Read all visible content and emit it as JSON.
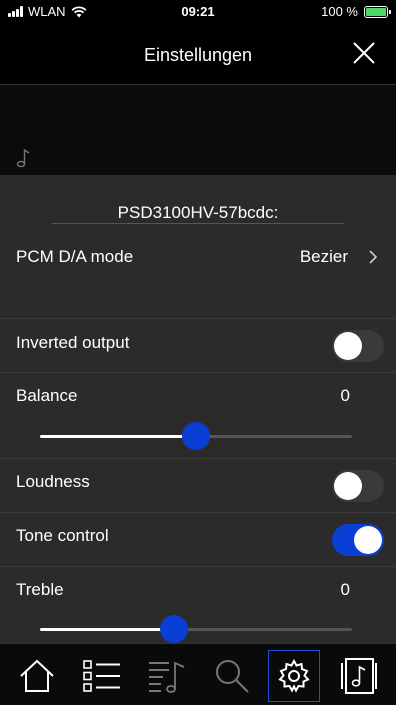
{
  "status": {
    "carrier": "WLAN",
    "time": "09:21",
    "battery": "100 %"
  },
  "nav": {
    "title": "Einstellungen"
  },
  "device": {
    "name": "PSD3100HV-57bcdc:"
  },
  "settings": {
    "pcm_mode": {
      "label": "PCM D/A mode",
      "value": "Bezier"
    },
    "inverted_output": {
      "label": "Inverted output",
      "on": false
    },
    "balance": {
      "label": "Balance",
      "value": "0",
      "position": 0.5
    },
    "loudness": {
      "label": "Loudness",
      "on": false
    },
    "tone_control": {
      "label": "Tone control",
      "on": true
    },
    "treble": {
      "label": "Treble",
      "value": "0",
      "position": 0.43
    }
  },
  "tabs": [
    {
      "icon": "home-icon"
    },
    {
      "icon": "list-icon"
    },
    {
      "icon": "playlist-icon"
    },
    {
      "icon": "search-icon"
    },
    {
      "icon": "settings-gear-icon",
      "selected": true
    },
    {
      "icon": "music-library-icon"
    }
  ],
  "colors": {
    "accent": "#0a3fd6",
    "background": "#2b2b2b",
    "charging": "#4cd964"
  }
}
